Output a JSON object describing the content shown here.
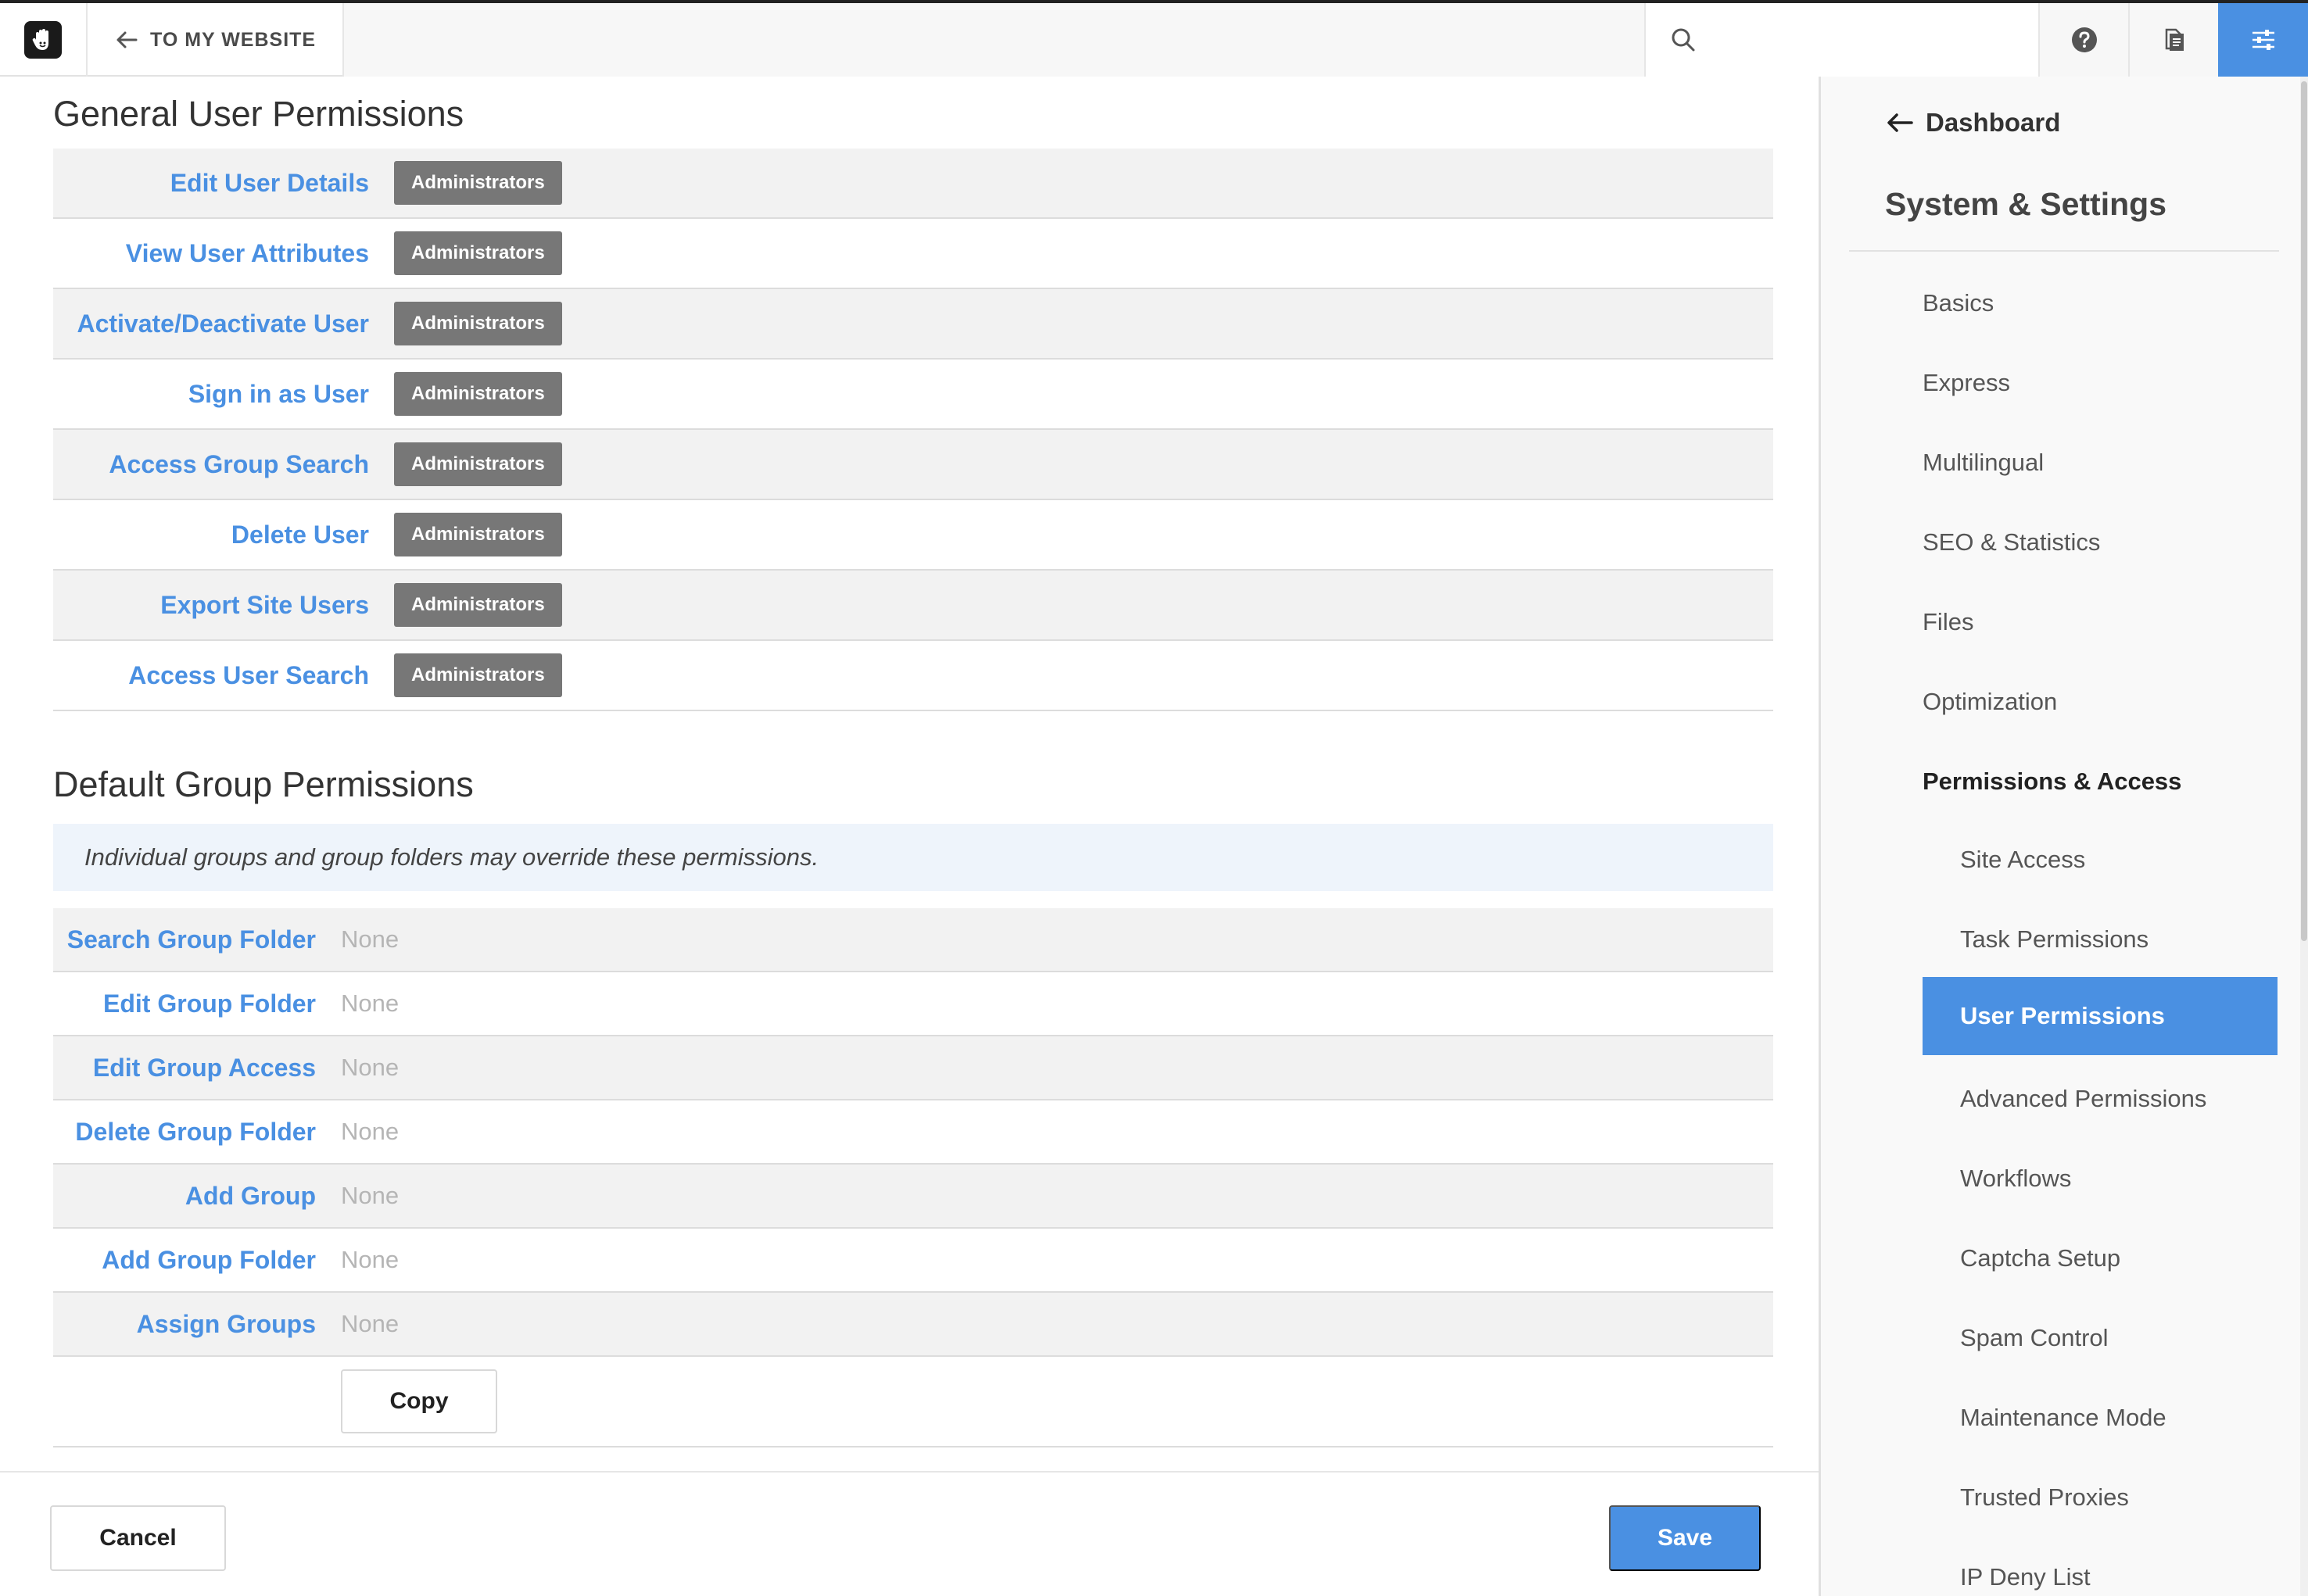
{
  "topbar": {
    "back_label": "TO MY WEBSITE",
    "search_placeholder": ""
  },
  "general": {
    "title": "General User Permissions",
    "rows": [
      {
        "label": "Edit User Details",
        "value": "Administrators"
      },
      {
        "label": "View User Attributes",
        "value": "Administrators"
      },
      {
        "label": "Activate/Deactivate User",
        "value": "Administrators"
      },
      {
        "label": "Sign in as User",
        "value": "Administrators"
      },
      {
        "label": "Access Group Search",
        "value": "Administrators"
      },
      {
        "label": "Delete User",
        "value": "Administrators"
      },
      {
        "label": "Export Site Users",
        "value": "Administrators"
      },
      {
        "label": "Access User Search",
        "value": "Administrators"
      }
    ]
  },
  "default_group": {
    "title": "Default Group Permissions",
    "note": "Individual groups and group folders may override these permissions.",
    "rows": [
      {
        "label": "Search Group Folder",
        "value": "None"
      },
      {
        "label": "Edit Group Folder",
        "value": "None"
      },
      {
        "label": "Edit Group Access",
        "value": "None"
      },
      {
        "label": "Delete Group Folder",
        "value": "None"
      },
      {
        "label": "Add Group",
        "value": "None"
      },
      {
        "label": "Add Group Folder",
        "value": "None"
      },
      {
        "label": "Assign Groups",
        "value": "None"
      }
    ],
    "copy_label": "Copy"
  },
  "footer": {
    "cancel_label": "Cancel",
    "save_label": "Save"
  },
  "sidebar": {
    "back_label": "Dashboard",
    "title": "System & Settings",
    "items": [
      {
        "label": "Basics"
      },
      {
        "label": "Express"
      },
      {
        "label": "Multilingual"
      },
      {
        "label": "SEO & Statistics"
      },
      {
        "label": "Files"
      },
      {
        "label": "Optimization"
      },
      {
        "label": "Permissions & Access"
      }
    ],
    "subitems": [
      {
        "label": "Site Access"
      },
      {
        "label": "Task Permissions"
      },
      {
        "label": "User Permissions"
      },
      {
        "label": "Advanced Permissions"
      },
      {
        "label": "Workflows"
      },
      {
        "label": "Captcha Setup"
      },
      {
        "label": "Spam Control"
      },
      {
        "label": "Maintenance Mode"
      },
      {
        "label": "Trusted Proxies"
      },
      {
        "label": "IP Deny List"
      }
    ]
  },
  "colors": {
    "accent": "#4a90e2",
    "badge": "#777777"
  }
}
